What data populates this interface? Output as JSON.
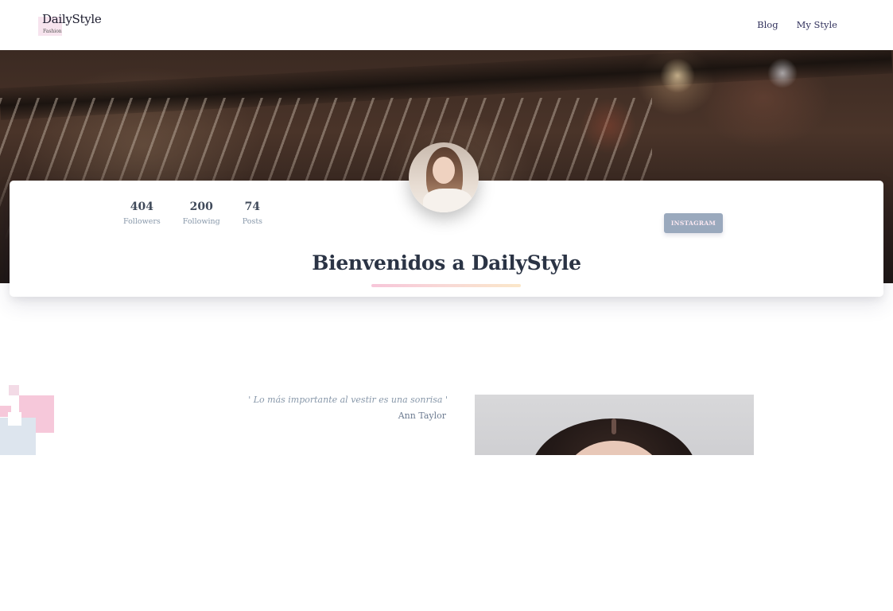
{
  "navbar": {
    "brand": {
      "name": "DailyStyle",
      "subtitle": "Fashion"
    },
    "links": [
      {
        "label": "Blog"
      },
      {
        "label": "My Style"
      }
    ]
  },
  "profile": {
    "stats": [
      {
        "value": "404",
        "label": "Followers"
      },
      {
        "value": "200",
        "label": "Following"
      },
      {
        "value": "74",
        "label": "Posts"
      }
    ],
    "instagram_button": "INSTAGRAM",
    "welcome_title": "Bienvenidos a DailyStyle"
  },
  "quote": {
    "text": "' Lo más importante al vestir es una sonrisa '",
    "author": "Ann Taylor"
  },
  "colors": {
    "accent_pink": "#f7c6d9",
    "button": "#9aa9bd",
    "heading": "#2b3445",
    "muted": "#8898aa"
  }
}
